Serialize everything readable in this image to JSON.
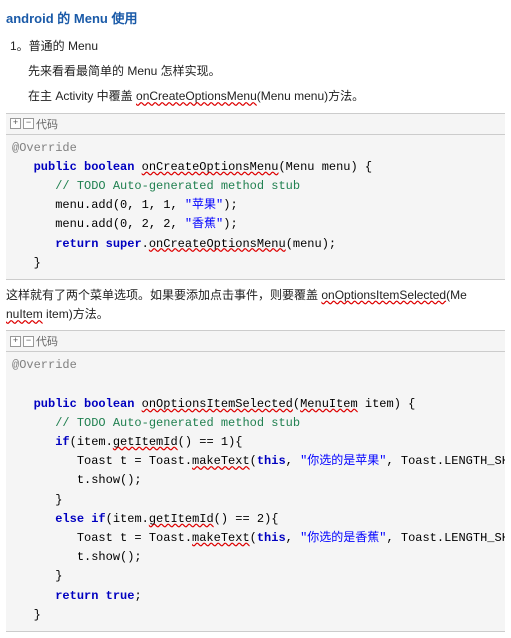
{
  "title": "android 的 Menu 使用",
  "p1": "1。普通的 Menu",
  "p2": "先来看看最简单的 Menu 怎样实现。",
  "p3_a": "在主 Activity 中覆盖 ",
  "p3_link": "onCreateOptionsMenu",
  "p3_b": "(Menu menu)方法。",
  "codebar_label": "代码",
  "box_plus": "+",
  "box_minus": "−",
  "c1": {
    "ann": "@Override",
    "kw_public": "public",
    "kw_boolean": "boolean",
    "fn": "onCreateOptionsMenu",
    "sig_rest": "(Menu menu) {",
    "comment": "// TODO Auto-generated method stub",
    "l1a": "menu.add(0, 1, 1, ",
    "l1s": "\"苹果\"",
    "l1b": ");",
    "l2a": "menu.add(0, 2, 2, ",
    "l2s": "\"香蕉\"",
    "l2b": ");",
    "kw_return": "return",
    "kw_super": "super",
    "ret_b": ".",
    "ret_fn": "onCreateOptionsMenu",
    "ret_c": "(menu);",
    "close": "}"
  },
  "mid_a": "这样就有了两个菜单选项。如果要添加点击事件，则要覆盖 ",
  "mid_link": "onOptionsItemSelected",
  "mid_b": "(Me",
  "mid_c": "nuItem",
  "mid_d": " item)方法。",
  "c2": {
    "ann": "@Override",
    "kw_public": "public",
    "kw_boolean": "boolean",
    "fn": "onOptionsItemSelected",
    "sig_a": "(",
    "sig_type": "MenuItem",
    "sig_b": " item) {",
    "comment": "// TODO Auto-generated method stub",
    "if_kw": "if",
    "if1_a": "(item.",
    "if1_fn": "getItemId",
    "if1_b": "() == 1){",
    "t1_a": "Toast t = Toast.",
    "t1_fn": "makeText",
    "t1_b": "(",
    "kw_this": "this",
    "t1_c": ", ",
    "t1_s": "\"你选的是苹果\"",
    "t1_d": ", Toast.LENGTH_SHORT);",
    "show": "t.show();",
    "close": "}",
    "else_kw": "else",
    "if2_a": "(item.",
    "if2_fn": "getItemId",
    "if2_b": "() == 2){",
    "t2_a": "Toast t = Toast.",
    "t2_fn": "makeText",
    "t2_b": "(",
    "t2_c": ", ",
    "t2_s": "\"你选的是香蕉\"",
    "t2_d": ", Toast.LENGTH_SHORT);",
    "kw_return": "return",
    "kw_true": "true",
    "semi": ";"
  }
}
